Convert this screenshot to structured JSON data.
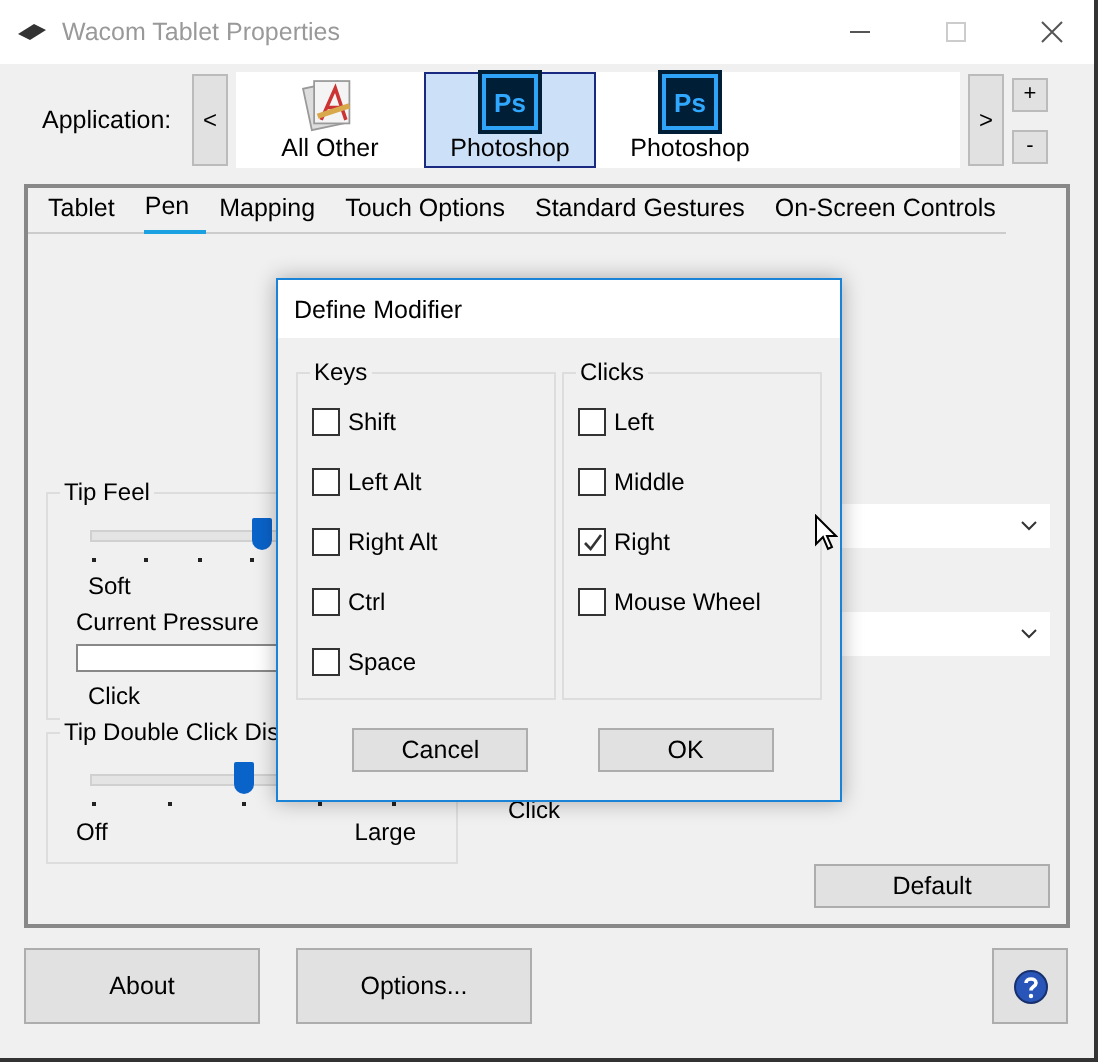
{
  "window": {
    "title": "Wacom Tablet Properties"
  },
  "application": {
    "label": "Application:",
    "prev": "<",
    "next": ">",
    "add": "+",
    "remove": "-",
    "apps": [
      {
        "name": "All Other",
        "kind": "generic",
        "selected": false
      },
      {
        "name": "Photoshop",
        "kind": "ps",
        "icon_text": "Ps",
        "selected": true
      },
      {
        "name": "Photoshop",
        "kind": "ps",
        "icon_text": "Ps",
        "selected": false
      }
    ]
  },
  "tabs": [
    {
      "label": "Tablet",
      "selected": false
    },
    {
      "label": "Pen",
      "selected": true
    },
    {
      "label": "Mapping",
      "selected": false
    },
    {
      "label": "Touch Options",
      "selected": false
    },
    {
      "label": "Standard Gestures",
      "selected": false
    },
    {
      "label": "On-Screen Controls",
      "selected": false
    }
  ],
  "tip_feel": {
    "title": "Tip Feel",
    "level": 0.5,
    "min_label": "Soft",
    "pressure_label": "Current Pressure",
    "click_label": "Click"
  },
  "double_click": {
    "title": "Tip Double Click Dis",
    "level": 0.5,
    "min_label": "Off",
    "max_label": "Large"
  },
  "click_label": "Click",
  "default_button": "Default",
  "dialog": {
    "title": "Define Modifier",
    "groups": [
      {
        "title": "Keys",
        "options": [
          {
            "label": "Shift",
            "checked": false
          },
          {
            "label": "Left Alt",
            "checked": false
          },
          {
            "label": "Right Alt",
            "checked": false
          },
          {
            "label": "Ctrl",
            "checked": false
          },
          {
            "label": "Space",
            "checked": false
          }
        ]
      },
      {
        "title": "Clicks",
        "options": [
          {
            "label": "Left",
            "checked": false
          },
          {
            "label": "Middle",
            "checked": false
          },
          {
            "label": "Right",
            "checked": true
          },
          {
            "label": "Mouse Wheel",
            "checked": false
          }
        ]
      }
    ],
    "buttons": [
      "Cancel",
      "OK"
    ]
  },
  "footer": {
    "buttons": [
      "About",
      "Options..."
    ]
  }
}
